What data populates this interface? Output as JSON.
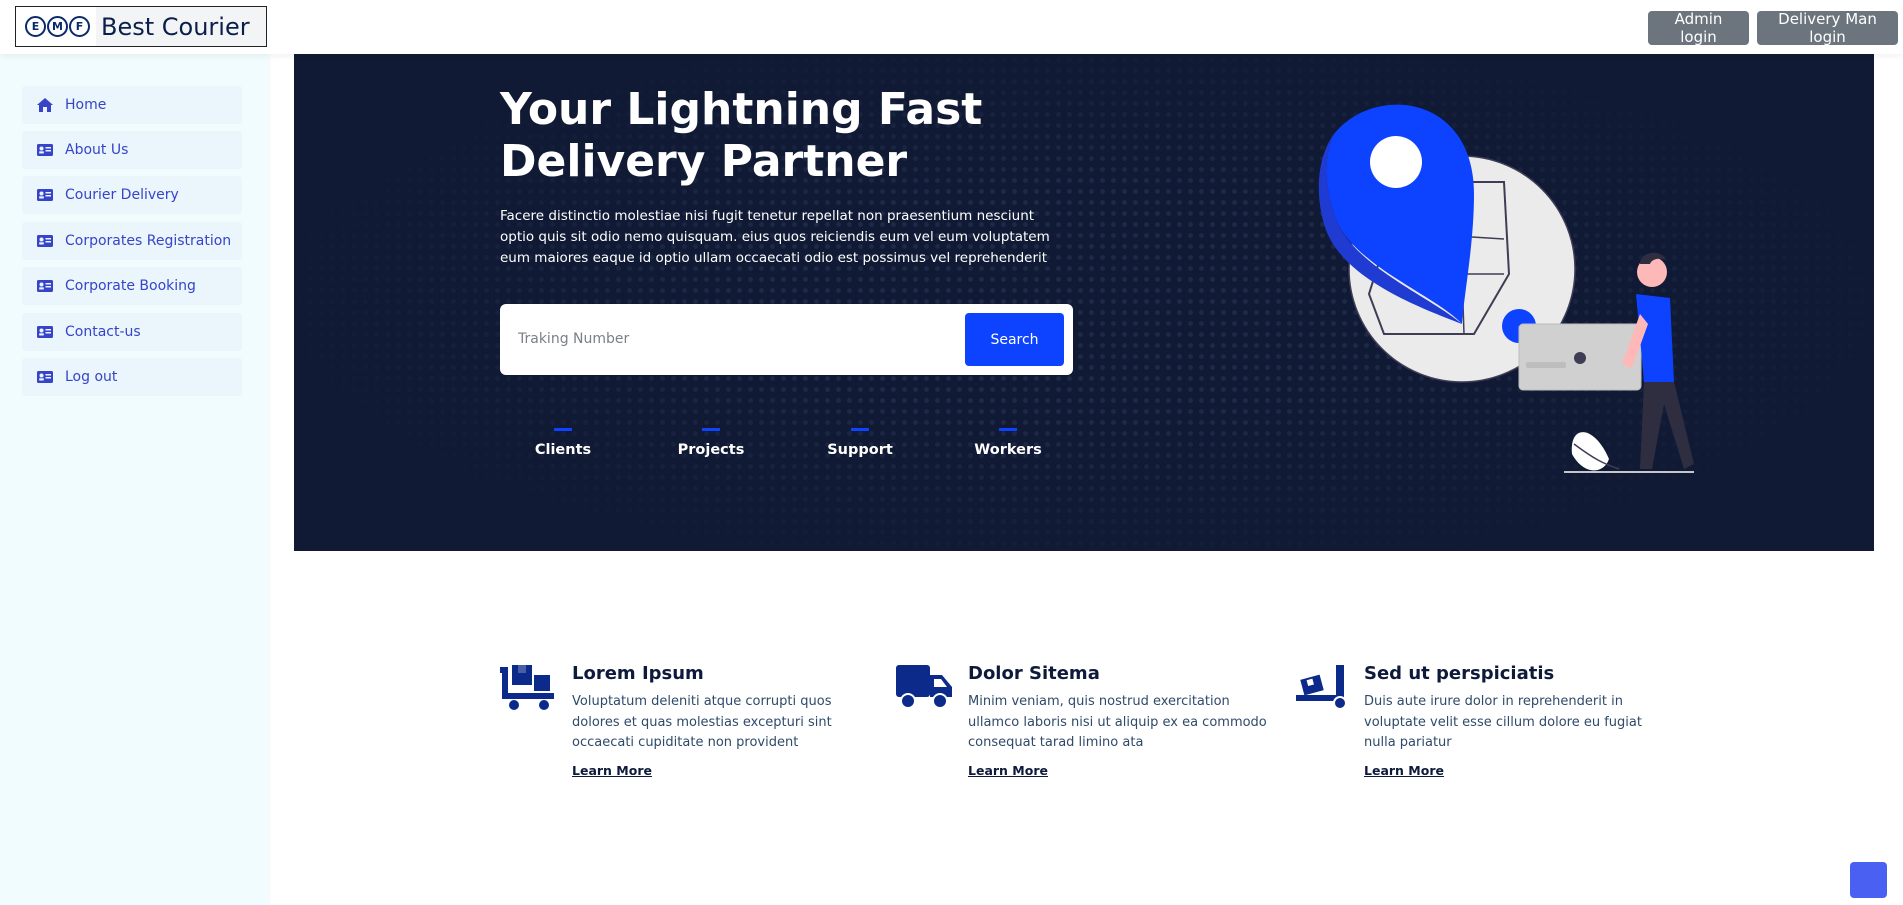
{
  "brand": {
    "logo_letters": [
      "E",
      "M",
      "F"
    ],
    "name": "Best Courier"
  },
  "header": {
    "admin_login": "Admin login",
    "delivery_login": "Delivery Man login"
  },
  "sidebar": {
    "items": [
      {
        "label": "Home",
        "icon": "home-icon"
      },
      {
        "label": "About Us",
        "icon": "id-card-icon"
      },
      {
        "label": "Courier Delivery",
        "icon": "id-card-icon"
      },
      {
        "label": "Corporates Registration",
        "icon": "id-card-icon"
      },
      {
        "label": "Corporate Booking",
        "icon": "id-card-icon"
      },
      {
        "label": "Contact-us",
        "icon": "id-card-icon"
      },
      {
        "label": "Log out",
        "icon": "id-card-icon"
      }
    ]
  },
  "hero": {
    "title": "Your Lightning Fast Delivery Partner",
    "description": "Facere distinctio molestiae nisi fugit tenetur repellat non praesentium nesciunt optio quis sit odio nemo quisquam. eius quos reiciendis eum vel eum voluptatem eum maiores eaque id optio ullam occaecati odio est possimus vel reprehenderit",
    "search_placeholder": "Traking Number",
    "search_button": "Search",
    "stats": [
      "Clients",
      "Projects",
      "Support",
      "Workers"
    ]
  },
  "features": [
    {
      "icon": "cart-boxes-icon",
      "title": "Lorem Ipsum",
      "text": "Voluptatum deleniti atque corrupti quos dolores et quas molestias excepturi sint occaecati cupiditate non provident",
      "link": "Learn More"
    },
    {
      "icon": "truck-icon",
      "title": "Dolor Sitema",
      "text": "Minim veniam, quis nostrud exercitation ullamco laboris nisi ut aliquip ex ea commodo consequat tarad limino ata",
      "link": "Learn More"
    },
    {
      "icon": "dolly-icon",
      "title": "Sed ut perspiciatis",
      "text": "Duis aute irure dolor in reprehenderit in voluptate velit esse cillum dolore eu fugiat nulla pariatur",
      "link": "Learn More"
    }
  ],
  "colors": {
    "hero_bg": "#101a34",
    "accent": "#0d42ff",
    "sidebar_bg": "#f0fcfd",
    "sidebar_text": "#3743c9",
    "top_button_bg": "#6c757d",
    "feature_icon": "#0b2a8a"
  }
}
